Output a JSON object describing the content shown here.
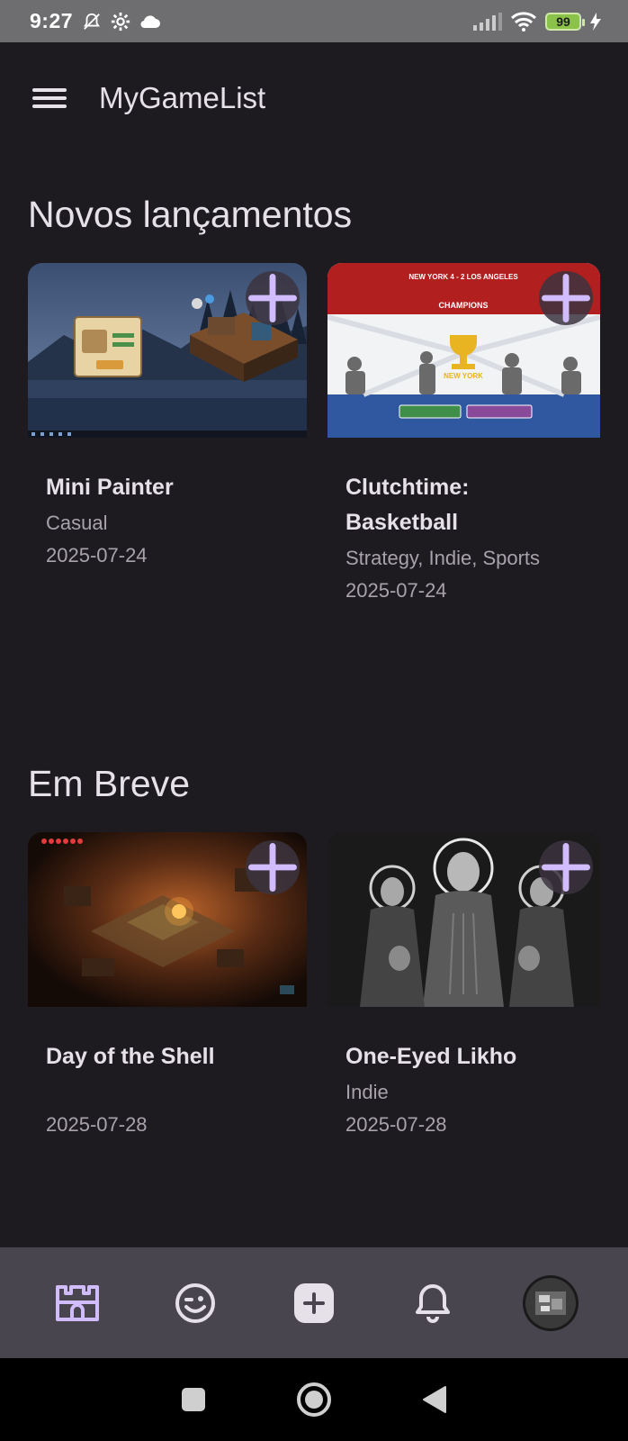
{
  "status_bar": {
    "time": "9:27",
    "battery": "99"
  },
  "app_bar": {
    "title": "MyGameList"
  },
  "sections": [
    {
      "title": "Novos lançamentos",
      "cards": [
        {
          "name": "Mini Painter",
          "genres": "Casual",
          "date": "2025-07-24"
        },
        {
          "name": "Clutchtime: Basketball",
          "genres": "Strategy, Indie, Sports",
          "date": "2025-07-24",
          "image_text": {
            "banner": "NEW YORK 4 - 2 LOS ANGELES",
            "champions": "CHAMPIONS",
            "team": "NEW YORK"
          }
        }
      ]
    },
    {
      "title": "Em Breve",
      "cards": [
        {
          "name": "Day of the Shell",
          "genres": "",
          "date": "2025-07-28"
        },
        {
          "name": "One-Eyed Likho",
          "genres": "Indie",
          "date": "2025-07-28"
        }
      ]
    }
  ],
  "colors": {
    "background": "#1d1b20",
    "accent": "#d0bcff",
    "nav_bg": "#49454f",
    "status_bar": "#6e6e70"
  },
  "bottom_nav": [
    "castle-icon",
    "smile-icon",
    "add-icon",
    "bell-icon",
    "avatar"
  ],
  "system_nav": [
    "square-icon",
    "circle-icon",
    "back-triangle-icon"
  ]
}
